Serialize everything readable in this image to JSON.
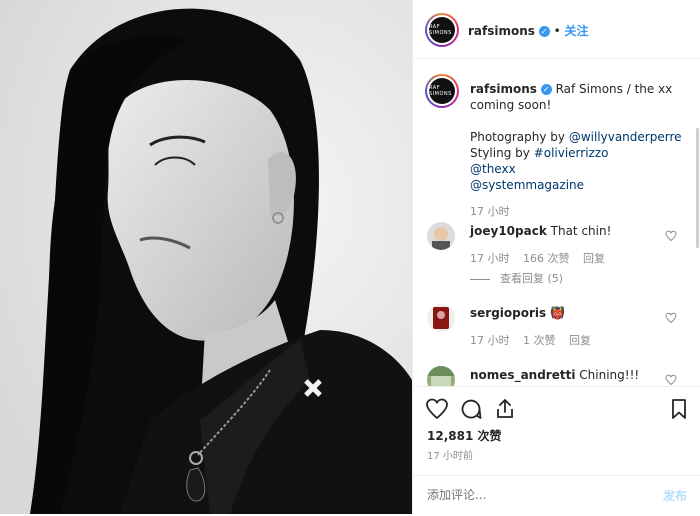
{
  "header": {
    "username": "rafsimons",
    "avatar_text": "RAF SIMONS",
    "follow_label": "关注",
    "separator": "•"
  },
  "caption": {
    "username": "rafsimons",
    "text": "Raf Simons / the xx coming soon!",
    "line3_prefix": "Photography by ",
    "line3_link": "@willyvanderperre",
    "line4_prefix": "Styling by ",
    "line4_link": "#olivierrizzo",
    "line5_link": "@thexx",
    "line6_link": "@systemmagazine",
    "time": "17 小时"
  },
  "comments": [
    {
      "username": "joey10pack",
      "text": "That chin!",
      "time": "17 小时",
      "likes": "166 次赞",
      "reply": "回复",
      "view_replies": "查看回复 (5)"
    },
    {
      "username": "sergioporis",
      "text": "👹",
      "time": "17 小时",
      "likes": "1 次赞",
      "reply": "回复"
    },
    {
      "username": "nomes_andretti",
      "text": "Chining!!!"
    }
  ],
  "actions": {
    "likes": "12,881 次赞",
    "time": "17 小时前",
    "comment_placeholder": "添加评论...",
    "post_label": "发布"
  },
  "colors": {
    "link": "#00376b",
    "follow": "#3897f0",
    "post_disabled": "#b2dffc",
    "muted": "#8e8e8e"
  }
}
